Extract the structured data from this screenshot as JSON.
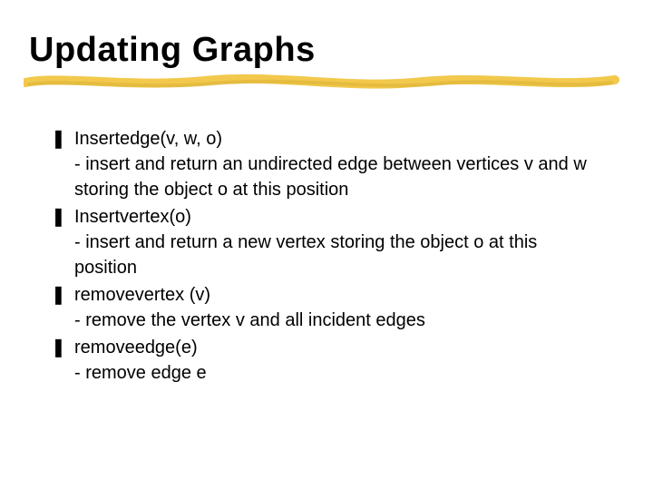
{
  "slide": {
    "title": "Updating Graphs",
    "bullet_char": "❚",
    "items": [
      {
        "term": "Insertedge(v, w, o)",
        "desc": "- insert and return an undirected edge between vertices v and w storing the object o at this position"
      },
      {
        "term": "Insertvertex(o)",
        "desc": "- insert and return a new vertex storing the object o at this position"
      },
      {
        "term": "removevertex (v)",
        "desc": "- remove the vertex v and all incident edges"
      },
      {
        "term": "removeedge(e)",
        "desc": "- remove edge e"
      }
    ]
  }
}
